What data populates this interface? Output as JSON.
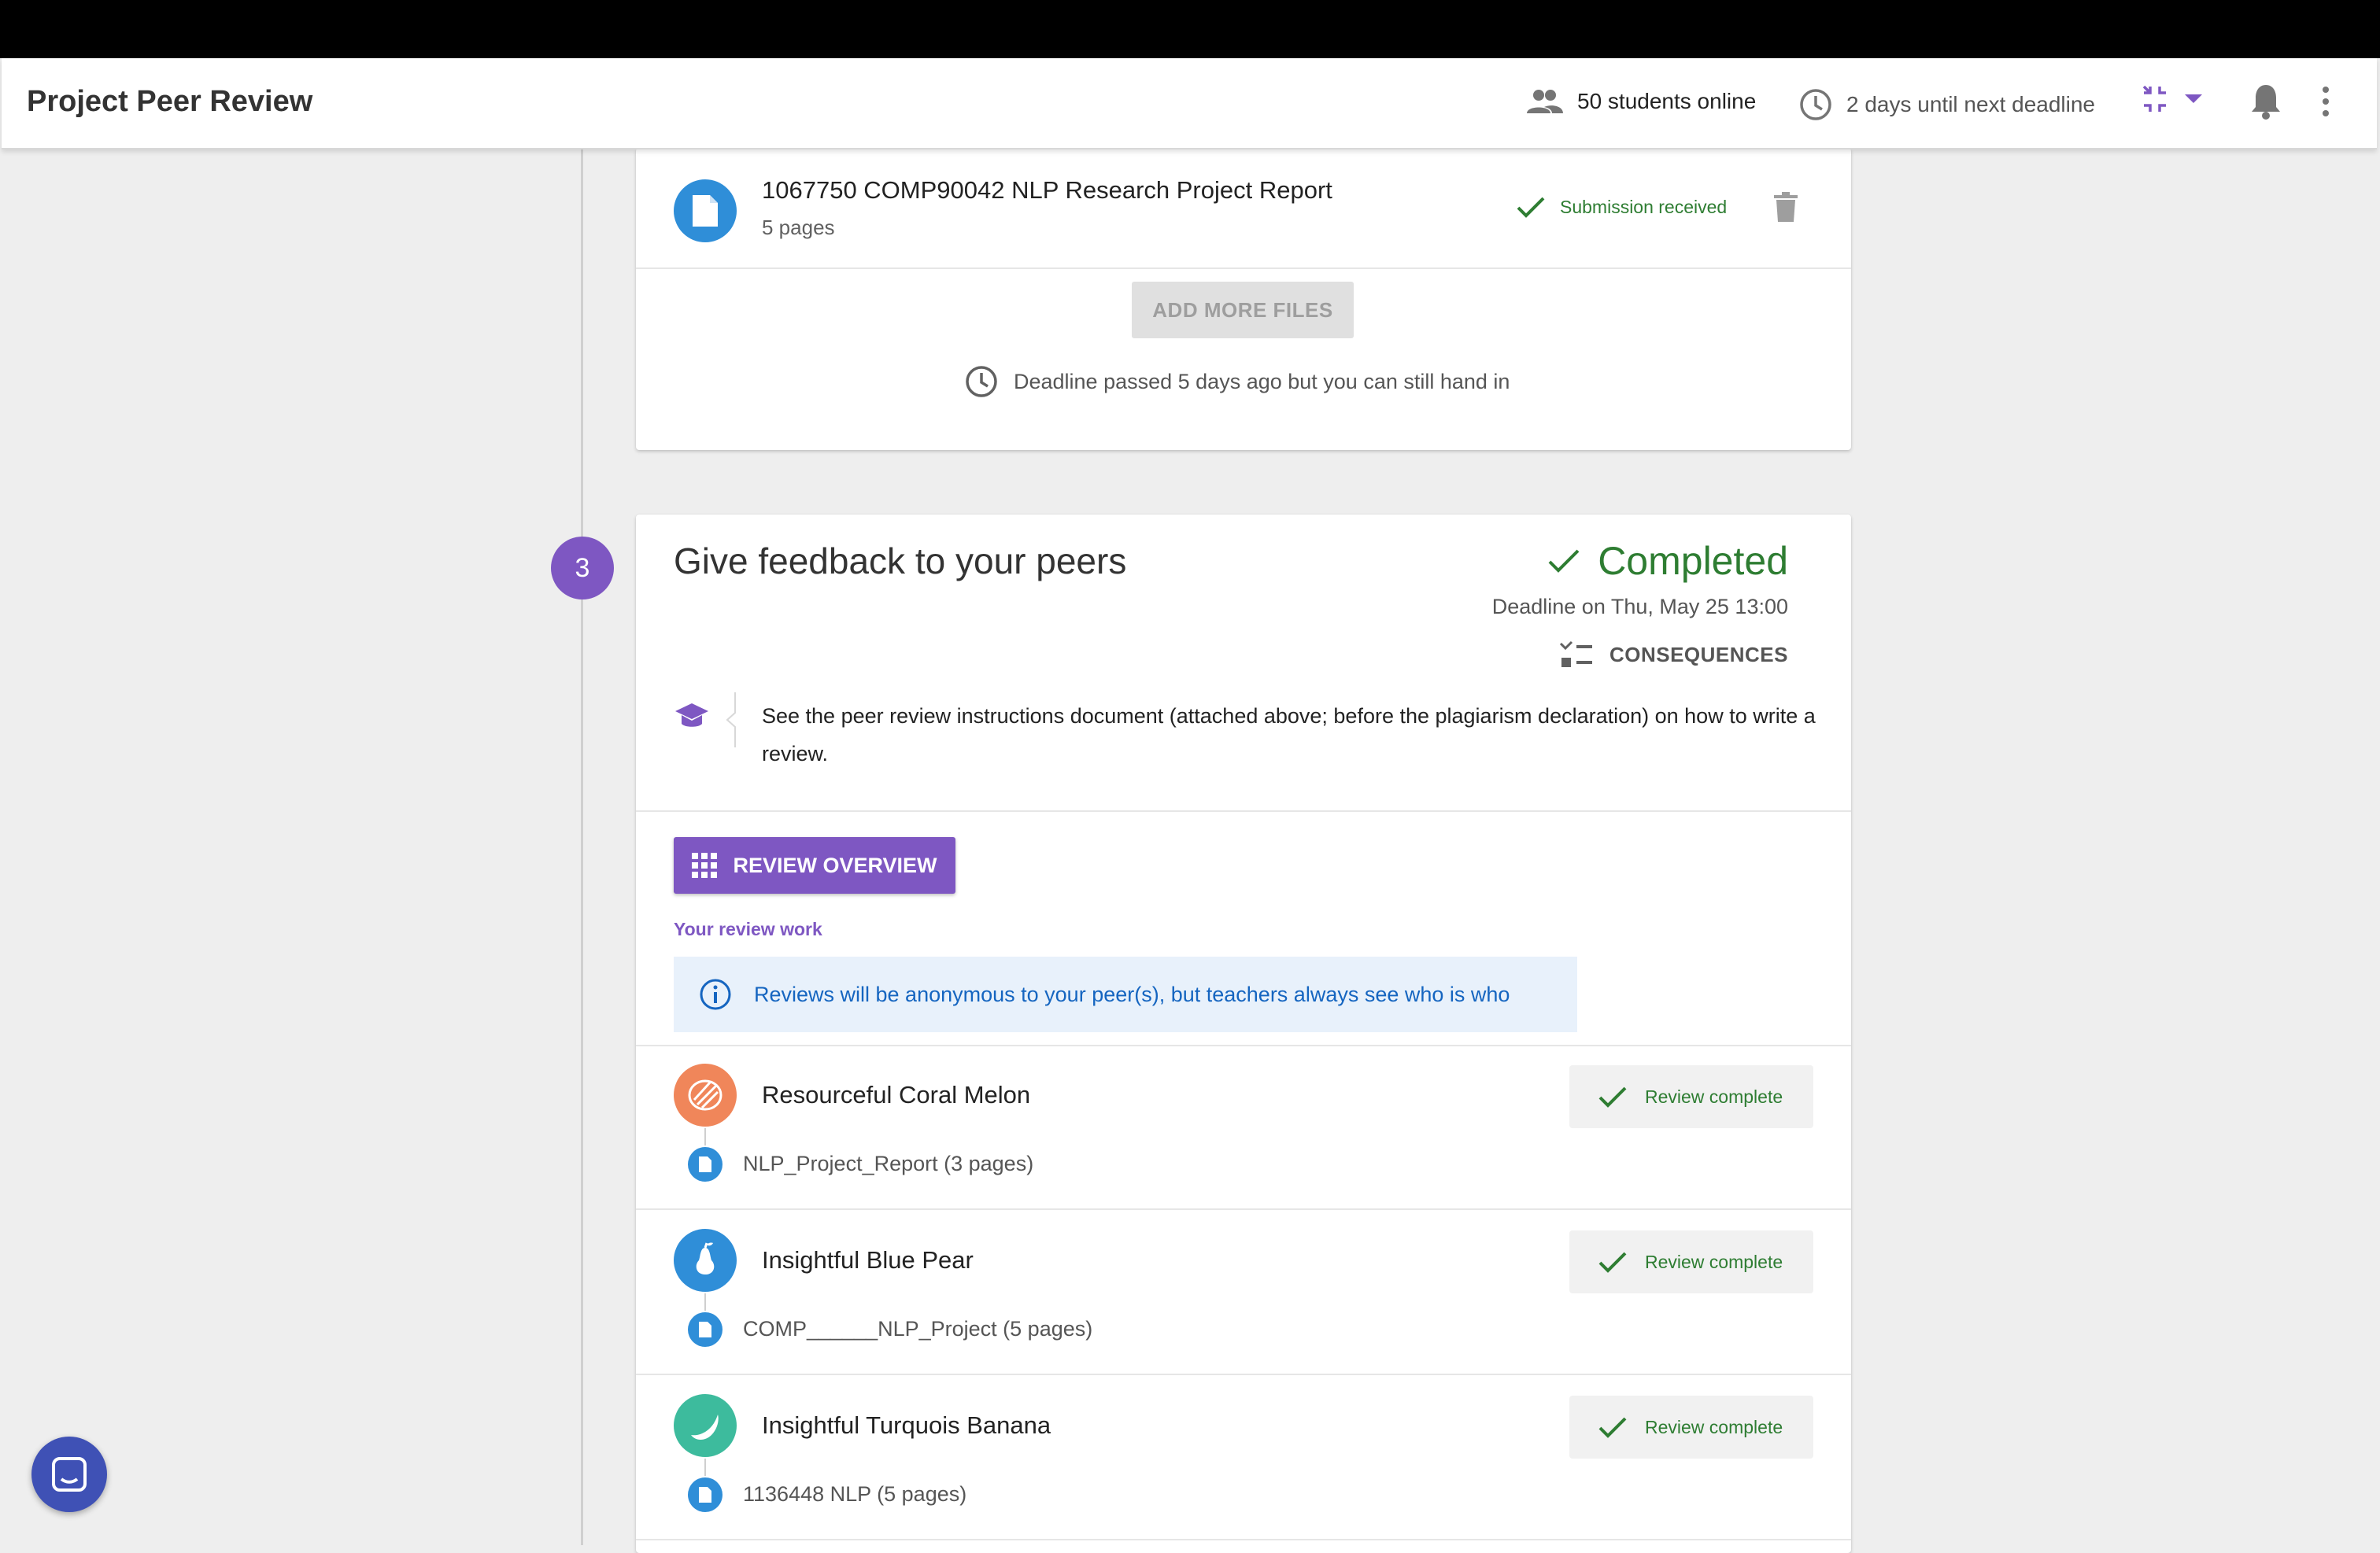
{
  "app": {
    "title": "Project Peer Review",
    "students_online": "50 students online",
    "next_deadline": "2 days until next deadline"
  },
  "submission": {
    "file_name": "1067750 COMP90042 NLP Research Project Report",
    "file_pages": "5 pages",
    "status": "Submission received",
    "add_more_label": "ADD MORE FILES",
    "deadline_note": "Deadline passed 5 days ago but you can still hand in"
  },
  "step": {
    "number": "3",
    "title": "Give feedback to your peers",
    "status": "Completed",
    "deadline": "Deadline on Thu, May 25 13:00",
    "consequences_label": "CONSEQUENCES",
    "instructions": "See the peer review instructions document (attached above; before the plagiarism declaration) on how to write a review.",
    "review_overview_label": "REVIEW OVERVIEW",
    "your_review_work": "Your review work",
    "anonymous_info": "Reviews will be anonymous to your peer(s), but teachers always see who is who"
  },
  "reviews": [
    {
      "peer": "Resourceful Coral Melon",
      "status": "Review complete",
      "document": "NLP_Project_Report (3 pages)",
      "color": "#f0865a",
      "icon": "melon-icon"
    },
    {
      "peer": "Insightful Blue Pear",
      "status": "Review complete",
      "document": "COMP______NLP_Project (5 pages)",
      "color": "#2f8ed8",
      "icon": "pear-icon"
    },
    {
      "peer": "Insightful Turquois Banana",
      "status": "Review complete",
      "document": "1136448 NLP (5 pages)",
      "color": "#3dbb9d",
      "icon": "banana-icon"
    }
  ],
  "colors": {
    "accent": "#7e57c2",
    "success": "#2e7d32",
    "info": "#1565c0",
    "file": "#2f8ed8"
  }
}
